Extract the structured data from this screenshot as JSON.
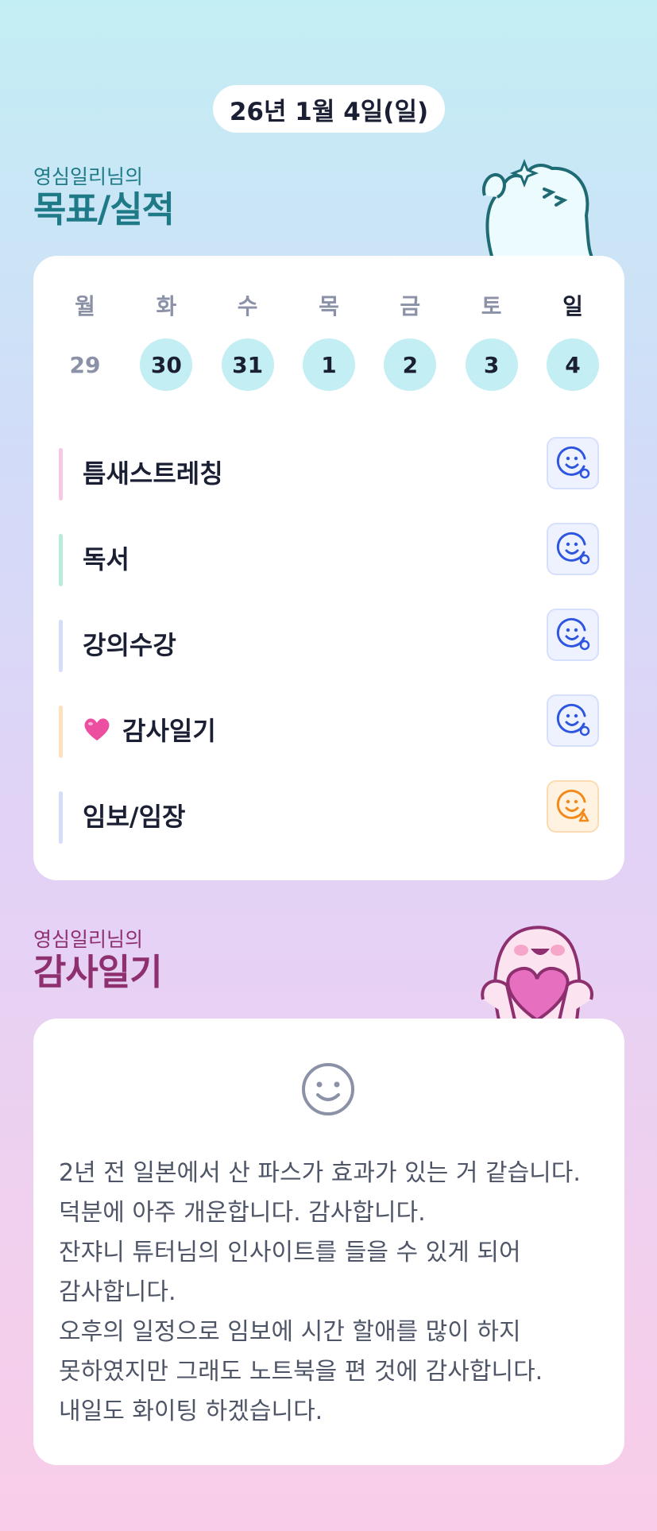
{
  "header": {
    "date": "26년 1월 4일(일)"
  },
  "goal_section": {
    "subtitle": "영심일리님의",
    "title": "목표/실적"
  },
  "week": {
    "days": [
      {
        "dow": "월",
        "date": "29",
        "state": "off"
      },
      {
        "dow": "화",
        "date": "30",
        "state": "done"
      },
      {
        "dow": "수",
        "date": "31",
        "state": "done"
      },
      {
        "dow": "목",
        "date": "1",
        "state": "done"
      },
      {
        "dow": "금",
        "date": "2",
        "state": "done"
      },
      {
        "dow": "토",
        "date": "3",
        "state": "done"
      },
      {
        "dow": "일",
        "date": "4",
        "state": "done",
        "today": true
      }
    ]
  },
  "goals": [
    {
      "label": "틈새스트레칭",
      "bar_color": "#f6c8e4",
      "status": "blue"
    },
    {
      "label": "독서",
      "bar_color": "#b8ecd9",
      "status": "blue"
    },
    {
      "label": "강의수강",
      "bar_color": "#d4defa",
      "status": "blue"
    },
    {
      "label": "감사일기",
      "bar_color": "#fde1bf",
      "status": "blue",
      "icon": "heart-icon"
    },
    {
      "label": "임보/임장",
      "bar_color": "#d4defa",
      "status": "orange"
    }
  ],
  "colors": {
    "status_blue": "#2d55e0",
    "status_orange": "#f28a1b",
    "goal_title": "#1e7a86",
    "gratitude_title": "#8e2f6f"
  },
  "gratitude_section": {
    "subtitle": "영심일리님의",
    "title": "감사일기",
    "text": "2년 전 일본에서 산 파스가 효과가 있는 거 같습니다. 덕분에 아주 개운합니다. 감사합니다.\n잔쟈니 튜터님의 인사이트를 들을 수 있게 되어 감사합니다.\n오후의 일정으로 임보에 시간 할애를 많이 하지 못하였지만 그래도 노트북을 편 것에 감사합니다. 내일도 화이팅 하겠습니다."
  }
}
